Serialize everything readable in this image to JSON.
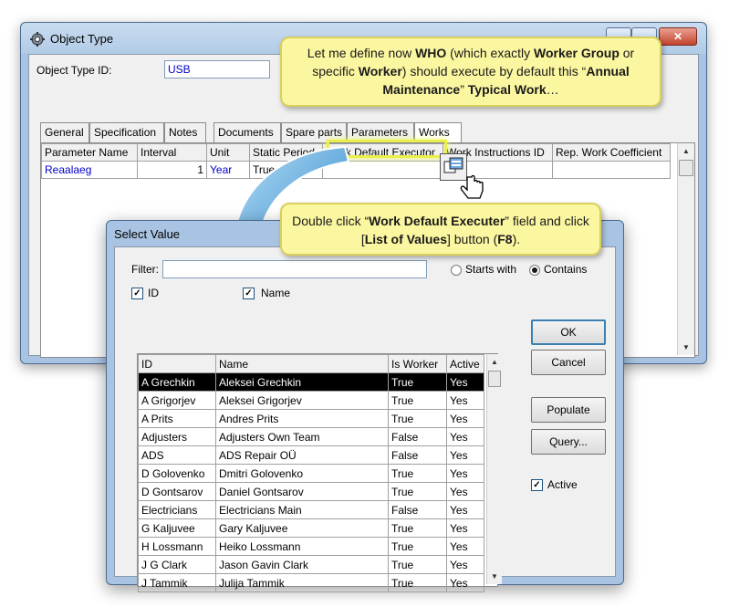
{
  "main_window": {
    "title": "Object Type",
    "object_type_id_label": "Object Type ID:",
    "object_type_id_value": "USB",
    "tabs": [
      "General",
      "Specification",
      "Notes",
      "Documents",
      "Spare parts",
      "Parameters",
      "Works"
    ],
    "grid": {
      "columns": [
        "Parameter Name",
        "Interval",
        "Unit",
        "Static Period",
        "Work Default Executor",
        "Work Instructions ID",
        "Rep. Work Coefficient"
      ],
      "rows": [
        {
          "parameter_name": "Reaalaeg",
          "interval": "1",
          "unit": "Year",
          "static_period": "True",
          "work_default_executor": "",
          "work_instructions_id": "",
          "rep_work_coefficient": ""
        }
      ]
    }
  },
  "select_window": {
    "title": "Select Value",
    "filter_label": "Filter:",
    "filter_value": "",
    "starts_with_label": "Starts with",
    "contains_label": "Contains",
    "filter_mode": "contains",
    "id_check_label": "ID",
    "name_check_label": "Name",
    "columns": [
      "ID",
      "Name",
      "Is Worker",
      "Active"
    ],
    "rows": [
      [
        "A Grechkin",
        "Aleksei Grechkin",
        "True",
        "Yes"
      ],
      [
        "A Grigorjev",
        "Aleksei Grigorjev",
        "True",
        "Yes"
      ],
      [
        "A Prits",
        "Andres Prits",
        "True",
        "Yes"
      ],
      [
        "Adjusters",
        "Adjusters Own Team",
        "False",
        "Yes"
      ],
      [
        "ADS",
        "ADS Repair OÜ",
        "False",
        "Yes"
      ],
      [
        "D Golovenko",
        "Dmitri Golovenko",
        "True",
        "Yes"
      ],
      [
        "D Gontsarov",
        "Daniel Gontsarov",
        "True",
        "Yes"
      ],
      [
        "Electricians",
        "Electricians Main",
        "False",
        "Yes"
      ],
      [
        "G Kaljuvee",
        "Gary Kaljuvee",
        "True",
        "Yes"
      ],
      [
        "H Lossmann",
        "Heiko Lossmann",
        "True",
        "Yes"
      ],
      [
        "J G Clark",
        "Jason Gavin Clark",
        "True",
        "Yes"
      ],
      [
        "J Tammik",
        "Julija Tammik",
        "True",
        "Yes"
      ]
    ],
    "buttons": {
      "ok": "OK",
      "cancel": "Cancel",
      "populate": "Populate",
      "query": "Query..."
    },
    "active_check_label": "Active"
  },
  "callouts": {
    "top": {
      "t1": "Let me define now ",
      "b1": "WHO",
      "t2": " (which exactly ",
      "b2": "Worker Group",
      "t3": " or specific ",
      "b3": "Worker",
      "t4": ") should execute by default this “",
      "b4": "Annual Maintenance",
      "t5": "” ",
      "b5": "Typical Work",
      "t6": "…"
    },
    "bottom": {
      "t1": "Double click “",
      "b1": "Work Default Executer",
      "t2": "” field and click [",
      "b2": "List of Values",
      "t3": "] button (",
      "b3": "F8",
      "t4": ")."
    }
  },
  "icons": [
    "app-gear-icon",
    "list-of-values-icon",
    "hand-cursor-icon",
    "curved-arrow"
  ],
  "colors": {
    "highlight": "#e9f04a",
    "callout_bg": "#fbf6a0",
    "arrow": "#2f8fd0",
    "link_text": "#0000cc"
  }
}
